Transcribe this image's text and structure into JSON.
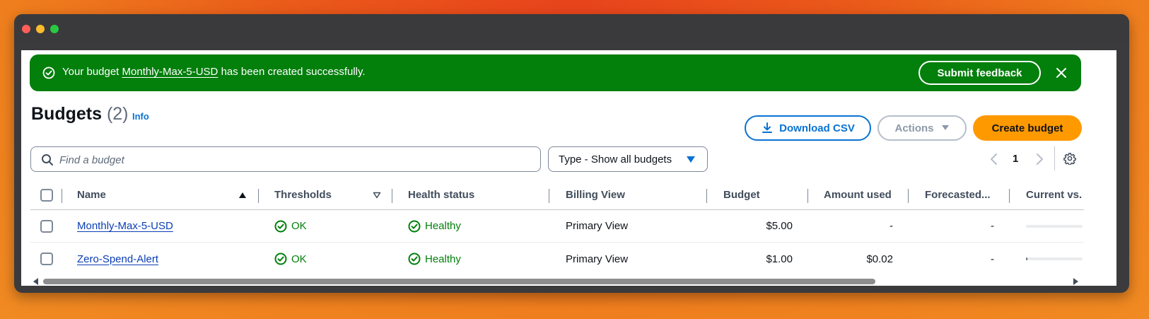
{
  "flash": {
    "prefix": "Your budget",
    "budget_link": "Monthly-Max-5-USD",
    "suffix": "has been created successfully.",
    "submit_feedback": "Submit feedback"
  },
  "header": {
    "title": "Budgets",
    "count": "(2)",
    "info": "Info",
    "download_csv": "Download CSV",
    "actions": "Actions",
    "create_budget": "Create budget"
  },
  "filters": {
    "search_placeholder": "Find a budget",
    "type_select": "Type - Show all budgets"
  },
  "pagination": {
    "current_page": "1"
  },
  "table": {
    "columns": [
      "Name",
      "Thresholds",
      "Health status",
      "Billing View",
      "Budget",
      "Amount used",
      "Forecasted...",
      "Current vs."
    ],
    "sort": {
      "name": "ascending",
      "thresholds": "descending"
    },
    "rows": [
      {
        "name": "Monthly-Max-5-USD",
        "thresholds": "OK",
        "health": "Healthy",
        "billing_view": "Primary View",
        "budget": "$5.00",
        "amount_used": "-",
        "forecasted": "-",
        "current_vs_progress": 0.0
      },
      {
        "name": "Zero-Spend-Alert",
        "thresholds": "OK",
        "health": "Healthy",
        "billing_view": "Primary View",
        "budget": "$1.00",
        "amount_used": "$0.02",
        "forecasted": "-",
        "current_vs_progress": 0.02
      }
    ]
  },
  "colors": {
    "success": "#037f0c",
    "link": "#0972d3",
    "primary_button": "#ff9900"
  }
}
